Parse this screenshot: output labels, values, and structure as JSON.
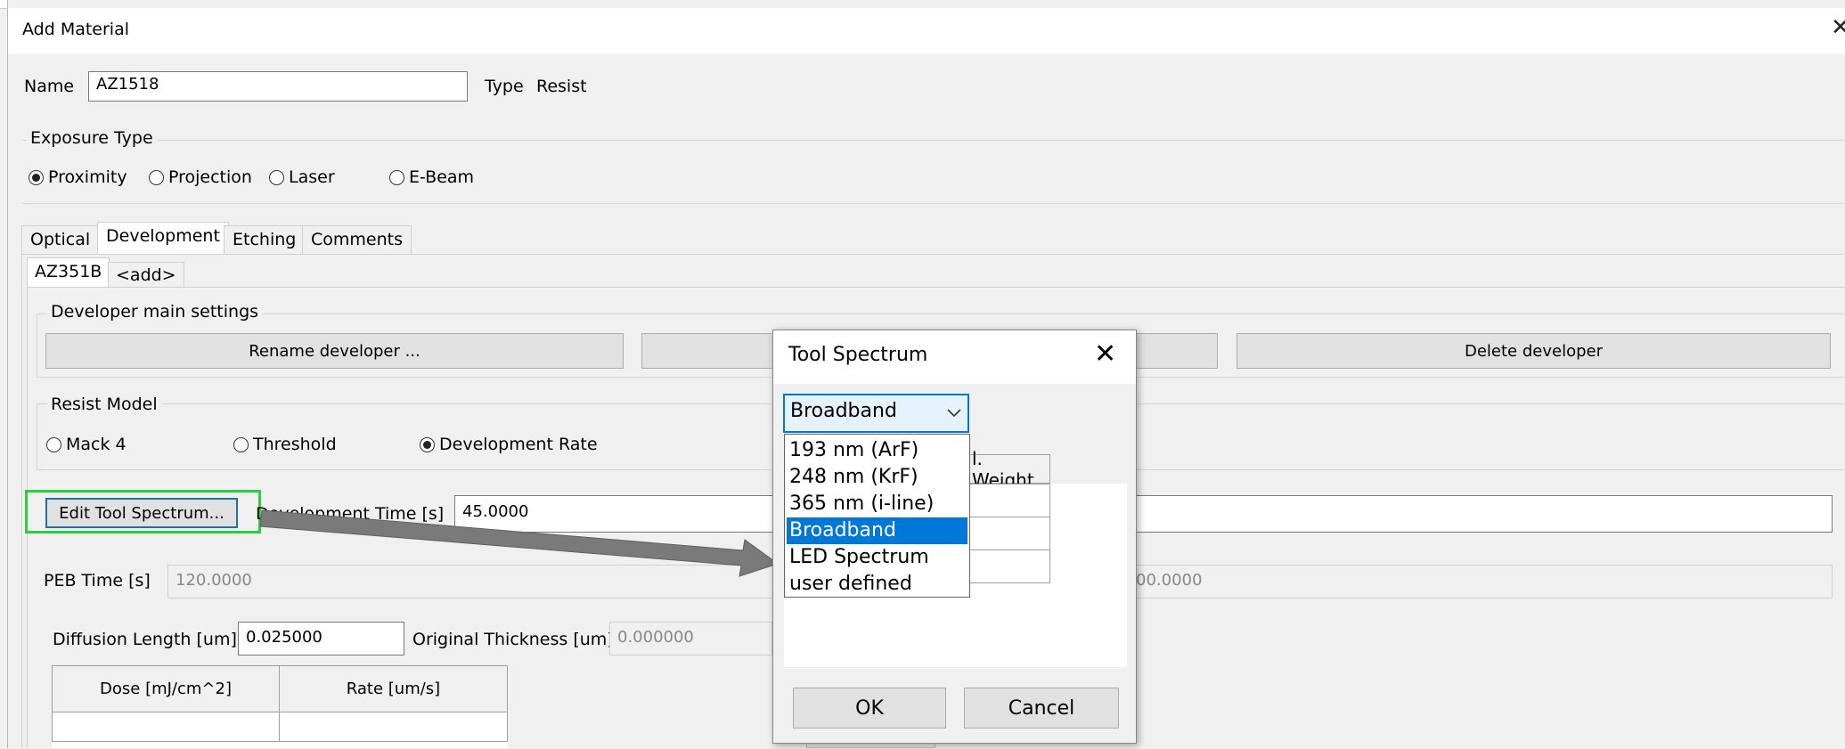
{
  "window": {
    "title": "Add Material",
    "close_glyph": "✕"
  },
  "name_label": "Name",
  "name_value": "AZ1518",
  "type_label": "Type",
  "type_value": "Resist",
  "exposure": {
    "title": "Exposure Type",
    "options": [
      "Proximity",
      "Projection",
      "Laser",
      "E-Beam"
    ],
    "selected": "Proximity"
  },
  "tabs": [
    "Optical",
    "Development",
    "Etching",
    "Comments"
  ],
  "active_tab": "Development",
  "subtabs": [
    "AZ351B",
    "<add>"
  ],
  "developer": {
    "title": "Developer main settings",
    "rename_button": "Rename developer ...",
    "delete_button": "Delete developer"
  },
  "resist_model": {
    "title": "Resist Model",
    "options": [
      "Mack 4",
      "Threshold",
      "Development Rate"
    ],
    "selected": "Development Rate"
  },
  "edit_tool_button": "Edit Tool Spectrum...",
  "dev_time": {
    "label": "Development Time [s]",
    "value": "45.0000"
  },
  "peb_time": {
    "label": "PEB Time [s]",
    "value": "120.0000"
  },
  "peb_right_value": "00.0000",
  "diffusion": {
    "label": "Diffusion Length [um]",
    "value": "0.025000"
  },
  "orig_thickness": {
    "label": "Original Thickness [um]",
    "value": "0.000000"
  },
  "rate_table": {
    "headers": [
      "Dose [mJ/cm^2]",
      "Rate [um/s]"
    ]
  },
  "dialog": {
    "title": "Tool Spectrum",
    "close_glyph": "✕",
    "combo_value": "Broadband",
    "options": [
      "193 nm (ArF)",
      "248 nm (KrF)",
      "365 nm (i-line)",
      "Broadband",
      "LED Spectrum",
      "user defined"
    ],
    "selected": "Broadband",
    "weight_header": "l. Weight",
    "ok": "OK",
    "cancel": "Cancel"
  },
  "colors": {
    "highlight_green": "#2ecc40",
    "selection_blue": "#0078d7",
    "arrow_gray": "#7a7a7a"
  }
}
